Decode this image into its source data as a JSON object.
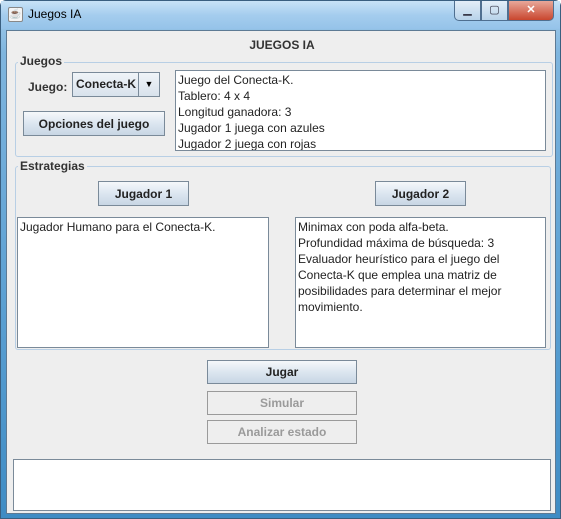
{
  "window": {
    "title": "Juegos IA"
  },
  "header": {
    "title": "JUEGOS IA"
  },
  "juegos": {
    "legend": "Juegos",
    "juego_label": "Juego:",
    "juego_selected": "Conecta-K",
    "options_button": "Opciones del juego",
    "description": "Juego del Conecta-K.\nTablero: 4 x 4\nLongitud ganadora: 3\nJugador 1 juega con azules\nJugador 2 juega con rojas"
  },
  "estrategias": {
    "legend": "Estrategias",
    "player1_button": "Jugador 1",
    "player2_button": "Jugador 2",
    "player1_description": "Jugador Humano para el Conecta-K.",
    "player2_description": "Minimax con poda alfa-beta.\nProfundidad máxima de búsqueda: 3\nEvaluador heurístico para el juego del Conecta-K que emplea una matriz de posibilidades para determinar el mejor movimiento."
  },
  "actions": {
    "play": "Jugar",
    "simulate": "Simular",
    "analyze": "Analizar estado"
  },
  "output": {
    "text": ""
  }
}
